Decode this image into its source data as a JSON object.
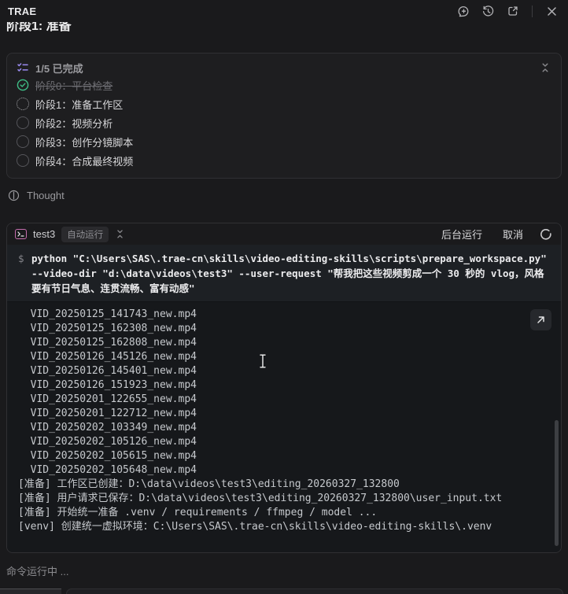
{
  "titlebar": {
    "app_title": "TRAE",
    "icons": {
      "new_chat": "new-chat-icon",
      "history": "history-icon",
      "open_external": "open-external-icon",
      "close": "close-icon"
    }
  },
  "clipped_heading": "阶段1: 准备",
  "progress_panel": {
    "header_label": "1/5 已完成",
    "stages": [
      {
        "label": "阶段0：平台检查",
        "status": "done"
      },
      {
        "label": "阶段1：准备工作区",
        "status": "running"
      },
      {
        "label": "阶段2：视频分析",
        "status": "pending"
      },
      {
        "label": "阶段3：创作分镜脚本",
        "status": "pending"
      },
      {
        "label": "阶段4：合成最终视频",
        "status": "pending"
      }
    ]
  },
  "thought": {
    "label": "Thought"
  },
  "terminal": {
    "tab_name": "test3",
    "badge": "自动运行",
    "background_run_label": "后台运行",
    "cancel_label": "取消",
    "prompt": "$",
    "command": "python \"C:\\Users\\SAS\\.trae-cn\\skills\\video-editing-skills\\scripts\\prepare_workspace.py\" --video-dir \"d:\\data\\videos\\test3\" --user-request \"帮我把这些视频剪成一个 30 秒的 vlog，风格要有节日气息、连贯流畅、富有动感\"",
    "output_lines": [
      "  VID_20250125_141743_new.mp4",
      "  VID_20250125_162308_new.mp4",
      "  VID_20250125_162808_new.mp4",
      "  VID_20250126_145126_new.mp4",
      "  VID_20250126_145401_new.mp4",
      "  VID_20250126_151923_new.mp4",
      "  VID_20250201_122655_new.mp4",
      "  VID_20250201_122712_new.mp4",
      "  VID_20250202_103349_new.mp4",
      "  VID_20250202_105126_new.mp4",
      "  VID_20250202_105615_new.mp4",
      "  VID_20250202_105648_new.mp4",
      "[准备] 工作区已创建：D:\\data\\videos\\test3\\editing_20260327_132800",
      "[准备] 用户请求已保存：D:\\data\\videos\\test3\\editing_20260327_132800\\user_input.txt",
      "[准备] 开始统一准备 .venv / requirements / ffmpeg / model ...",
      "[venv] 创建统一虚拟环境：C:\\Users\\SAS\\.trae-cn\\skills\\video-editing-skills\\.venv"
    ]
  },
  "status_bar": {
    "text": "命令运行中 ..."
  },
  "colors": {
    "accent_purple": "#9c8cf2",
    "success_green": "#3fbf87",
    "terminal_icon_pink": "#c66fae",
    "page_bg": "#1a1a1c",
    "output_bg": "#16181b"
  }
}
